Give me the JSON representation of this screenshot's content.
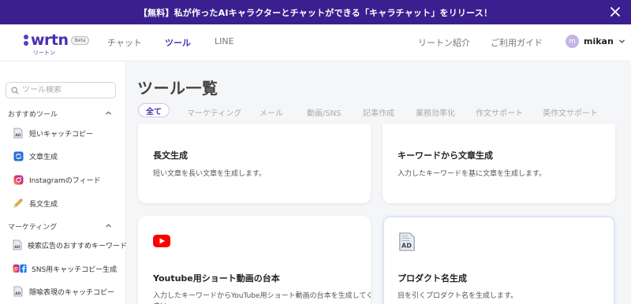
{
  "banner": {
    "text": "【無料】私が作ったAIキャラクターとチャットができる「キャラチャット」をリリース！"
  },
  "header": {
    "logo": "wrtn",
    "logo_sub": "リートン",
    "beta": "Beta",
    "nav": [
      {
        "label": "チャット"
      },
      {
        "label": "ツール"
      },
      {
        "label": "LINE"
      },
      {
        "label": "リートン紹介"
      },
      {
        "label": "ご利用ガイド"
      }
    ],
    "user": {
      "avatar_initial": "m",
      "name": "mikan"
    }
  },
  "sidebar": {
    "search_placeholder": "ツール検索",
    "sections": [
      {
        "label": "おすすめツール",
        "items": [
          {
            "label": "短いキャッチコピー",
            "icon": "ad-document-icon"
          },
          {
            "label": "文章生成",
            "icon": "refresh-icon"
          },
          {
            "label": "Instagramのフィード",
            "icon": "instagram-icon"
          },
          {
            "label": "長文生成",
            "icon": "pencil-icon"
          }
        ]
      },
      {
        "label": "マーケティング",
        "items": [
          {
            "label": "検索広告のおすすめキーワード",
            "icon": "ad-document-icon"
          },
          {
            "label": "SNS用キャッチコピー生成",
            "icon": "instagram-facebook-icon"
          },
          {
            "label": "隠喩表現のキャッチコピー",
            "icon": "ad-document-icon"
          }
        ]
      }
    ]
  },
  "main": {
    "title": "ツール一覧",
    "tabs": [
      {
        "label": "全て"
      },
      {
        "label": "マーケティング"
      },
      {
        "label": "メール"
      },
      {
        "label": "動画/SNS"
      },
      {
        "label": "記事作成"
      },
      {
        "label": "業務効率化"
      },
      {
        "label": "作文サポート"
      },
      {
        "label": "英作文サポート"
      }
    ],
    "cards": [
      {
        "title": "長文生成",
        "desc": "短い文章を長い文章を生成します。"
      },
      {
        "title": "キーワードから文章生成",
        "desc": "入力したキーワードを基に文章を生成します。"
      },
      {
        "title": "Youtube用ショート動画の台本",
        "desc": "入力したキーワードからYouTube用ショート動画の台本を生成してくだ",
        "desc2": "さい",
        "icon": "youtube-icon"
      },
      {
        "title": "プロダクト名生成",
        "desc": "目を引くプロダクト名を生成します。",
        "icon": "ad-document-icon"
      }
    ]
  },
  "colors": {
    "banner_bg": "#3b1f8f",
    "accent": "#4a2fb0",
    "youtube_red": "#ff0000"
  }
}
